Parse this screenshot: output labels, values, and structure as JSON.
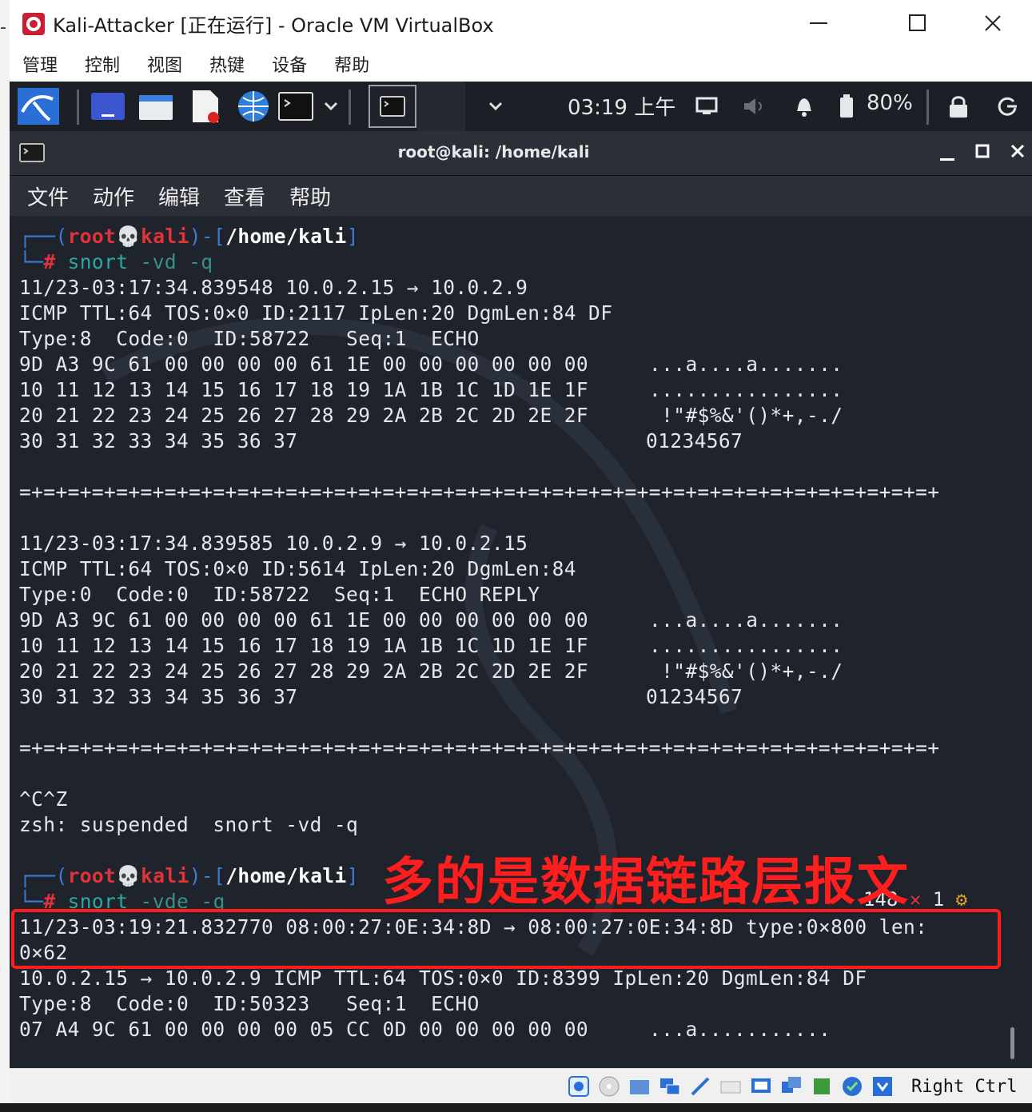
{
  "vbox": {
    "title": "Kali-Attacker [正在运行] - Oracle VM VirtualBox",
    "menu": [
      "管理",
      "控制",
      "视图",
      "热键",
      "设备",
      "帮助"
    ],
    "host_key": "Right Ctrl"
  },
  "kali_panel": {
    "clock": "03:19 上午",
    "battery": "80%"
  },
  "terminal": {
    "title": "root@kali: /home/kali",
    "menu": [
      "文件",
      "动作",
      "编辑",
      "查看",
      "帮助"
    ],
    "prompt1": {
      "user": "root",
      "host": "kali",
      "path": "/home/kali",
      "cmd": "snort",
      "args": "-vd -q"
    },
    "packet1": {
      "header": "11/23-03:17:34.839548 10.0.2.15 → 10.0.2.9",
      "line2": "ICMP TTL:64 TOS:0×0 ID:2117 IpLen:20 DgmLen:84 DF",
      "line3": "Type:8  Code:0  ID:58722   Seq:1  ECHO",
      "hex": [
        "9D A3 9C 61 00 00 00 00 61 1E 00 00 00 00 00 00",
        "10 11 12 13 14 15 16 17 18 19 1A 1B 1C 1D 1E 1F",
        "20 21 22 23 24 25 26 27 28 29 2A 2B 2C 2D 2E 2F",
        "30 31 32 33 34 35 36 37"
      ],
      "ascii": [
        "...a....a.......",
        "................",
        " !\"#$%&'()*+,-./",
        "01234567"
      ]
    },
    "separator": "=+=+=+=+=+=+=+=+=+=+=+=+=+=+=+=+=+=+=+=+=+=+=+=+=+=+=+=+=+=+=+=+=+=+=+=+=+=+",
    "packet2": {
      "header": "11/23-03:17:34.839585 10.0.2.9 → 10.0.2.15",
      "line2": "ICMP TTL:64 TOS:0×0 ID:5614 IpLen:20 DgmLen:84",
      "line3": "Type:0  Code:0  ID:58722  Seq:1  ECHO REPLY",
      "hex": [
        "9D A3 9C 61 00 00 00 00 61 1E 00 00 00 00 00 00",
        "10 11 12 13 14 15 16 17 18 19 1A 1B 1C 1D 1E 1F",
        "20 21 22 23 24 25 26 27 28 29 2A 2B 2C 2D 2E 2F",
        "30 31 32 33 34 35 36 37"
      ],
      "ascii": [
        "...a....a.......",
        "................",
        " !\"#$%&'()*+,-./",
        "01234567"
      ]
    },
    "ctrl": "^C^Z",
    "suspended": "zsh: suspended  snort -vd -q",
    "prompt2": {
      "user": "root",
      "host": "kali",
      "path": "/home/kali",
      "cmd": "snort",
      "args": "-vde -q"
    },
    "rprompt": {
      "count": "148",
      "mark": "✕",
      "jobs": "1",
      "gear": "⚙"
    },
    "packet3": {
      "eth_line1": "11/23-03:19:21.832770 08:00:27:0E:34:8D → 08:00:27:0E:34:8D type:0×800 len:",
      "eth_line2": "0×62",
      "line3": "10.0.2.15 → 10.0.2.9 ICMP TTL:64 TOS:0×0 ID:8399 IpLen:20 DgmLen:84 DF",
      "line4": "Type:8  Code:0  ID:50323   Seq:1  ECHO",
      "hex": "07 A4 9C 61 00 00 00 00 05 CC 0D 00 00 00 00 00",
      "ascii": "...a..........."
    }
  },
  "annotation": "多的是数据链路层报文",
  "colors": {
    "annotation": "#ff1e1e",
    "prompt_red": "#e0333a",
    "prompt_blue": "#3a7cd6",
    "command": "#2ba8a0"
  }
}
